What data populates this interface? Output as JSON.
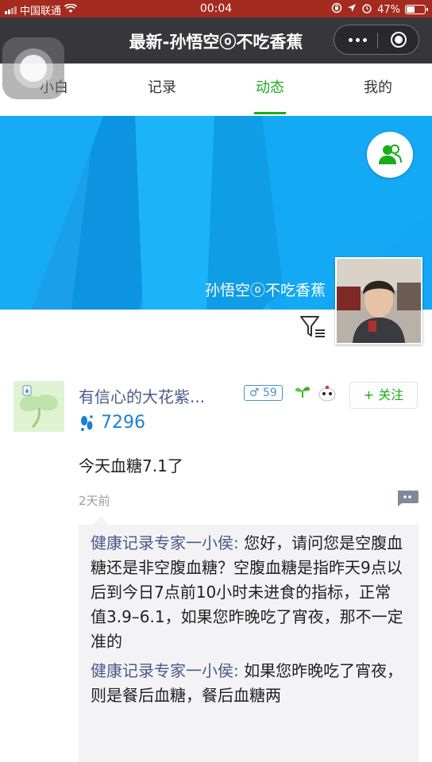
{
  "status_bar": {
    "carrier": "中国联通",
    "time": "00:04",
    "battery_percent": "47%",
    "battery_level": 0.47
  },
  "title_bar": {
    "title": "最新-孙悟空ⓞ不吃香蕉"
  },
  "tabs": [
    {
      "label": "小白"
    },
    {
      "label": "记录"
    },
    {
      "label": "动态"
    },
    {
      "label": "我的"
    }
  ],
  "active_tab": 2,
  "banner": {
    "user_name": "孙悟空ⓞ不吃香蕉"
  },
  "post": {
    "author": "有信心的大花紫...",
    "gender_age": "♂ 59",
    "follow_label": "+ 关注",
    "steps": "7296",
    "text": "今天血糖7.1了",
    "time": "2天前",
    "comments": [
      {
        "author": "健康记录专家一小侯:",
        "text": " 您好，请问您是空腹血糖还是非空腹血糖？空腹血糖是指昨天9点以后到今日7点前10小时未进食的指标，正常值3.9–6.1，如果您昨晚吃了宵夜，那不一定准的"
      },
      {
        "author": "健康记录专家一小侯:",
        "text": " 如果您昨晚吃了宵夜，则是餐后血糖，餐后血糖两"
      }
    ]
  },
  "colors": {
    "status_bar": "#a52a1f",
    "title_bar": "#37363b",
    "accent_green": "#1aad19",
    "banner_blue": "#12a6f4",
    "link_blue": "#4a5a8a"
  },
  "icons": {
    "wifi": "wifi-icon",
    "friends": "friends-icon",
    "filter": "filter-icon",
    "footprint": "footprint-icon",
    "comment": "comment-icon"
  }
}
